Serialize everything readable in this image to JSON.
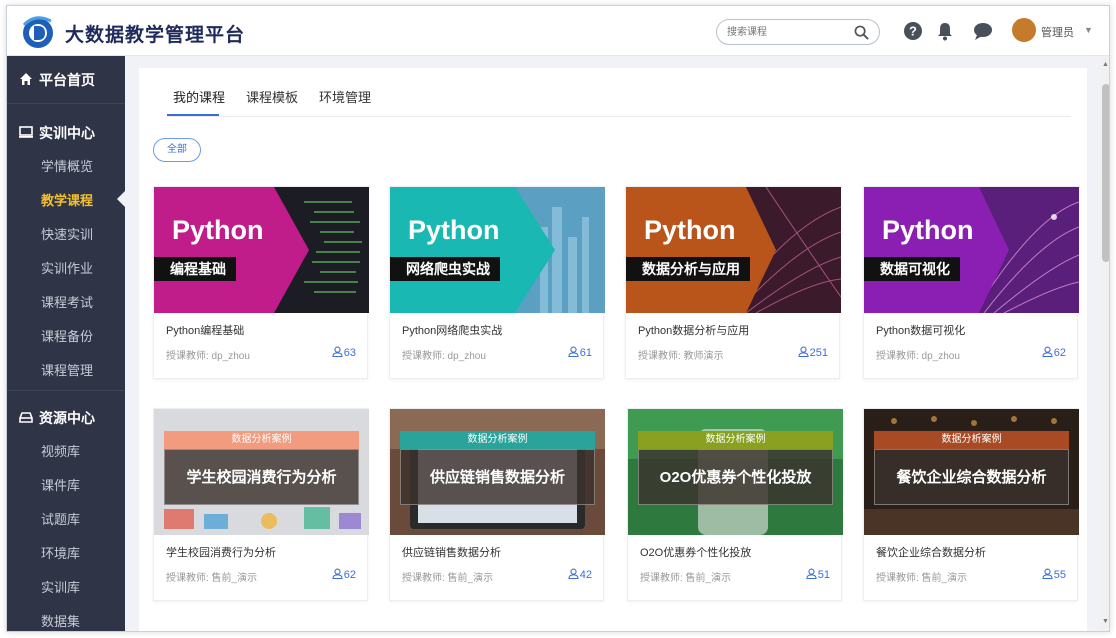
{
  "header": {
    "brand": "大数据教学管理平台",
    "search_placeholder": "搜索课程",
    "user_name": "管理员"
  },
  "sidebar": {
    "home": "平台首页",
    "groups": [
      {
        "label": "实训中心",
        "items": [
          "学情概览",
          "教学课程",
          "快速实训",
          "实训作业",
          "课程考试",
          "课程备份",
          "课程管理"
        ]
      },
      {
        "label": "资源中心",
        "items": [
          "视频库",
          "课件库",
          "试题库",
          "环境库",
          "实训库",
          "数据集"
        ]
      }
    ],
    "active_item": "教学课程"
  },
  "tabs": [
    "我的课程",
    "课程模板",
    "环境管理"
  ],
  "filter_label": "全部",
  "colors": {
    "accent": "#3a6fd8",
    "sidebar_bg": "#2f3447",
    "active_item": "#f5c02e"
  },
  "courses": [
    {
      "cover_title": "Python",
      "cover_subtitle": "编程基础",
      "title": "Python编程基础",
      "teacher": "授课教师: dp_zhou",
      "count": "63",
      "color": "#c01d8a"
    },
    {
      "cover_title": "Python",
      "cover_subtitle": "网络爬虫实战",
      "title": "Python网络爬虫实战",
      "teacher": "授课教师: dp_zhou",
      "count": "61",
      "color": "#1ab8b2"
    },
    {
      "cover_title": "Python",
      "cover_subtitle": "数据分析与应用",
      "title": "Python数据分析与应用",
      "teacher": "授课教师: 教师演示",
      "count": "251",
      "color": "#b9541a"
    },
    {
      "cover_title": "Python",
      "cover_subtitle": "数据可视化",
      "title": "Python数据可视化",
      "teacher": "授课教师: dp_zhou",
      "count": "62",
      "color": "#8b1fb3"
    },
    {
      "cover_badge": "数据分析案例",
      "cover_main": "学生校园消费行为分析",
      "title": "学生校园消费行为分析",
      "teacher": "授课教师: 售前_演示",
      "count": "62",
      "color": "#f29b7f"
    },
    {
      "cover_badge": "数据分析案例",
      "cover_main": "供应链销售数据分析",
      "title": "供应链销售数据分析",
      "teacher": "授课教师: 售前_演示",
      "count": "42",
      "color": "#2aa39a"
    },
    {
      "cover_badge": "数据分析案例",
      "cover_main": "O2O优惠券个性化投放",
      "title": "O2O优惠券个性化投放",
      "teacher": "授课教师: 售前_演示",
      "count": "51",
      "color": "#8aa020"
    },
    {
      "cover_badge": "数据分析案例",
      "cover_main": "餐饮企业综合数据分析",
      "title": "餐饮企业综合数据分析",
      "teacher": "授课教师: 售前_演示",
      "count": "55",
      "color": "#a84a24"
    }
  ]
}
